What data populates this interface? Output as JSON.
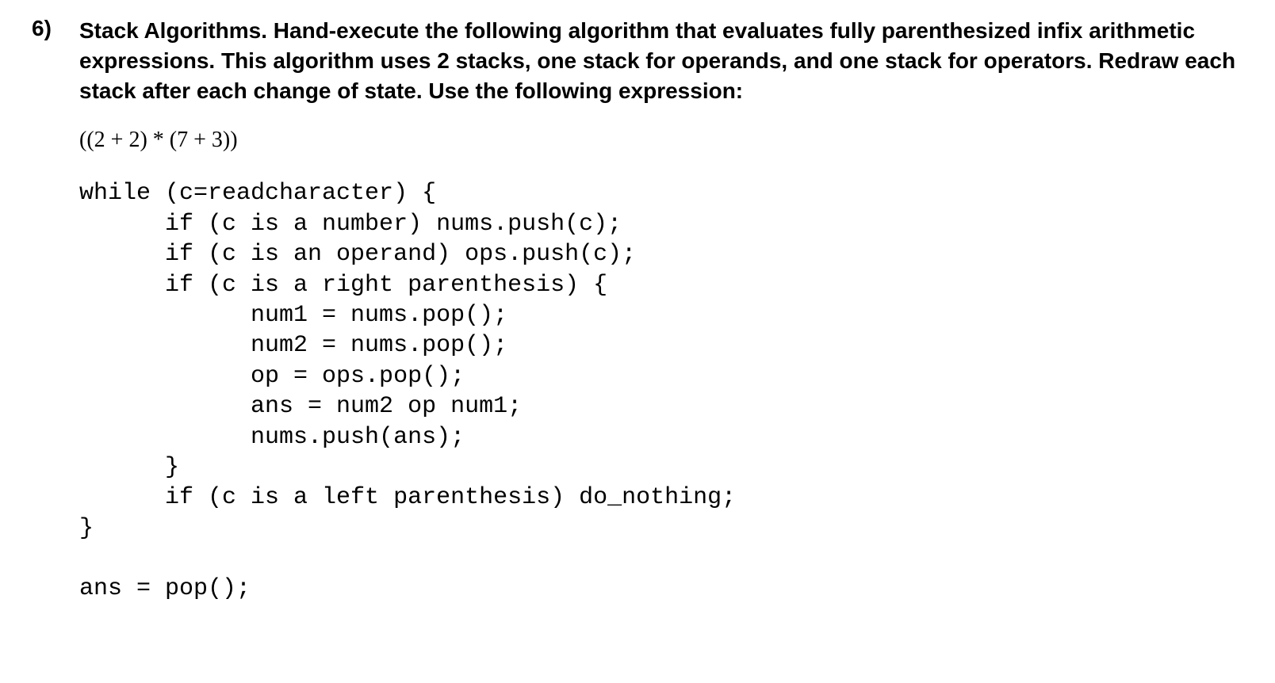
{
  "question": {
    "number": "6)",
    "text": "Stack Algorithms.  Hand-execute the following algorithm that evaluates fully parenthesized infix arithmetic expressions.  This algorithm uses 2 stacks, one stack for operands, and one stack for operators.  Redraw each stack after each change of state.  Use the following expression:"
  },
  "expression": "((2 + 2) * (7 + 3))",
  "code": "while (c=readcharacter) {\n      if (c is a number) nums.push(c);\n      if (c is an operand) ops.push(c);\n      if (c is a right parenthesis) {\n            num1 = nums.pop();\n            num2 = nums.pop();\n            op = ops.pop();\n            ans = num2 op num1;\n            nums.push(ans);\n      }\n      if (c is a left parenthesis) do_nothing;\n}\n\nans = pop();"
}
